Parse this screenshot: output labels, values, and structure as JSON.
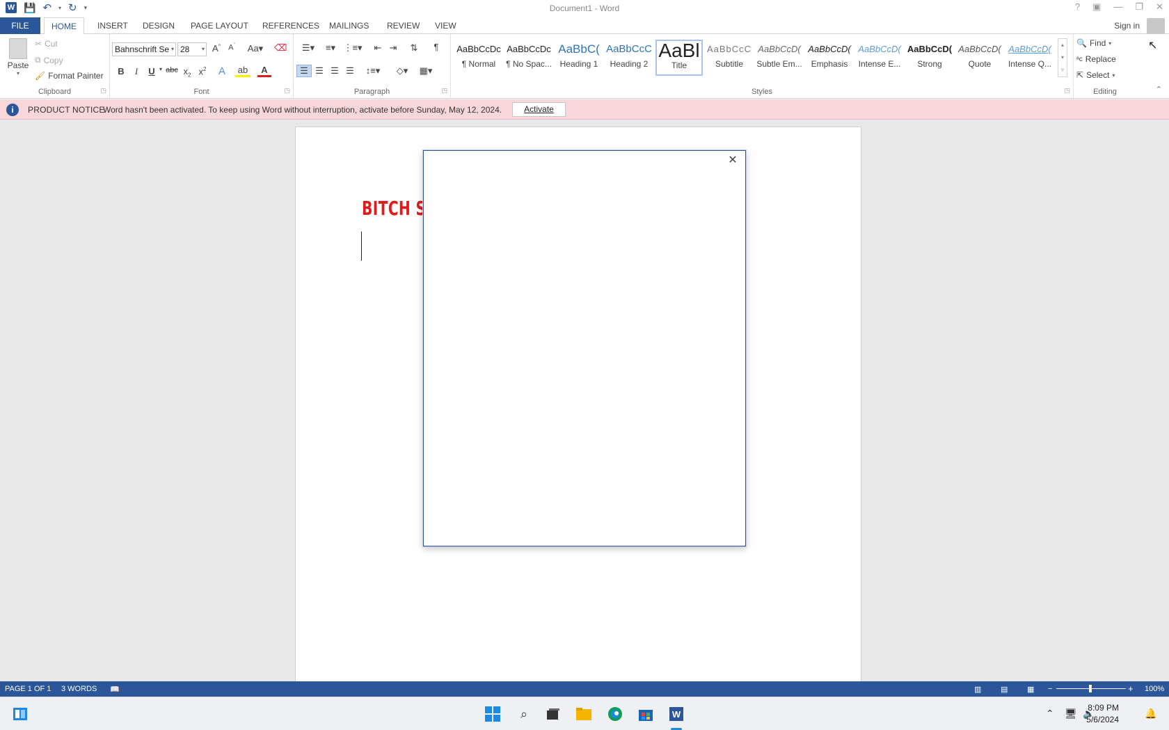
{
  "window": {
    "title": "Document1 - Word",
    "controls": [
      "?",
      "▣",
      "—",
      "❐",
      "✕"
    ]
  },
  "tabs": {
    "file": "FILE",
    "items": [
      "HOME",
      "INSERT",
      "DESIGN",
      "PAGE LAYOUT",
      "REFERENCES",
      "MAILINGS",
      "REVIEW",
      "VIEW"
    ],
    "active": "HOME",
    "sign_in": "Sign in"
  },
  "clipboard": {
    "paste": "Paste",
    "cut": "Cut",
    "copy": "Copy",
    "format_painter": "Format Painter",
    "label": "Clipboard"
  },
  "font": {
    "name": "Bahnschrift Se",
    "size": "28",
    "label": "Font",
    "color_accent": "#e01b1b",
    "highlight_accent": "#ffee00"
  },
  "paragraph": {
    "label": "Paragraph"
  },
  "styles": {
    "label": "Styles",
    "items": [
      {
        "sample": "AaBbCcDc",
        "name": "¶ Normal"
      },
      {
        "sample": "AaBbCcDc",
        "name": "¶ No Spac..."
      },
      {
        "sample": "AaBbC(",
        "name": "Heading 1"
      },
      {
        "sample": "AaBbCcC",
        "name": "Heading 2"
      },
      {
        "sample": "AaBl",
        "name": "Title"
      },
      {
        "sample": "AaBbCcC",
        "name": "Subtitle"
      },
      {
        "sample": "AaBbCcD(",
        "name": "Subtle Em..."
      },
      {
        "sample": "AaBbCcD(",
        "name": "Emphasis"
      },
      {
        "sample": "AaBbCcD(",
        "name": "Intense E..."
      },
      {
        "sample": "AaBbCcD(",
        "name": "Strong"
      },
      {
        "sample": "AaBbCcD(",
        "name": "Quote"
      },
      {
        "sample": "AaBbCcD(",
        "name": "Intense Q..."
      }
    ],
    "selected": "Title"
  },
  "editing": {
    "label": "Editing",
    "find": "Find",
    "replace": "Replace",
    "select": "Select"
  },
  "notice": {
    "label": "PRODUCT NOTICE",
    "message": "Word hasn't been activated. To keep using Word without interruption, activate before Sunday, May 12, 2024.",
    "button": "Activate"
  },
  "document": {
    "heading_text": "BITCH S"
  },
  "statusbar": {
    "page": "PAGE 1 OF 1",
    "words": "3 WORDS",
    "zoom": "100%"
  },
  "taskbar": {
    "time": "8:09 PM",
    "date": "5/6/2024"
  }
}
